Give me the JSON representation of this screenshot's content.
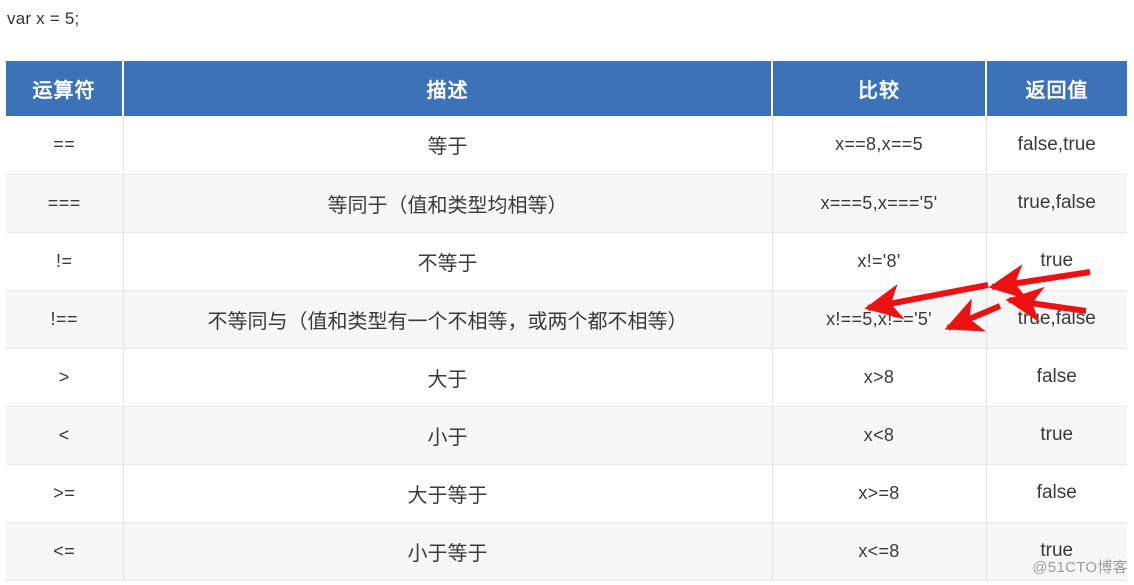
{
  "code_snippet": "var x = 5;",
  "table": {
    "headers": [
      {
        "label": "运算符",
        "key": "operator"
      },
      {
        "label": "描述",
        "key": "description"
      },
      {
        "label": "比较",
        "key": "comparison"
      },
      {
        "label": "返回值",
        "key": "result"
      }
    ],
    "rows": [
      {
        "operator": "==",
        "description": "等于",
        "comparison": "x==8,x==5",
        "result": "false,true"
      },
      {
        "operator": "===",
        "description": "等同于（值和类型均相等）",
        "comparison": "x===5,x==='5'",
        "result": "true,false"
      },
      {
        "operator": "!=",
        "description": "不等于",
        "comparison": "x!='8'",
        "result": "true"
      },
      {
        "operator": "!==",
        "description": "不等同与（值和类型有一个不相等，或两个都不相等）",
        "comparison": "x!==5,x!=='5'",
        "result": "true,false"
      },
      {
        "operator": ">",
        "description": "大于",
        "comparison": "x>8",
        "result": "false"
      },
      {
        "operator": "<",
        "description": "小于",
        "comparison": "x<8",
        "result": "true"
      },
      {
        "operator": ">=",
        "description": "大于等于",
        "comparison": "x>=8",
        "result": "false"
      },
      {
        "operator": "<=",
        "description": "小于等于",
        "comparison": "x<=8",
        "result": "true"
      }
    ]
  },
  "watermark": "@51CTO博客",
  "colors": {
    "header_blue": "#3B72B8",
    "header_text": "#ffffff",
    "row_odd": "#ffffff",
    "row_even": "#f7f7f7",
    "grid_line": "#e3e3e3",
    "body_text": "#3a3a3a",
    "annotation_red": "#ee1111",
    "watermark_gray": "#9d9d9d"
  },
  "annotations": {
    "arrow_color": "#ee1111",
    "count": 4,
    "note": "红色箭头指向 x!==5,x!=='5' 与 true,false 单元格"
  }
}
